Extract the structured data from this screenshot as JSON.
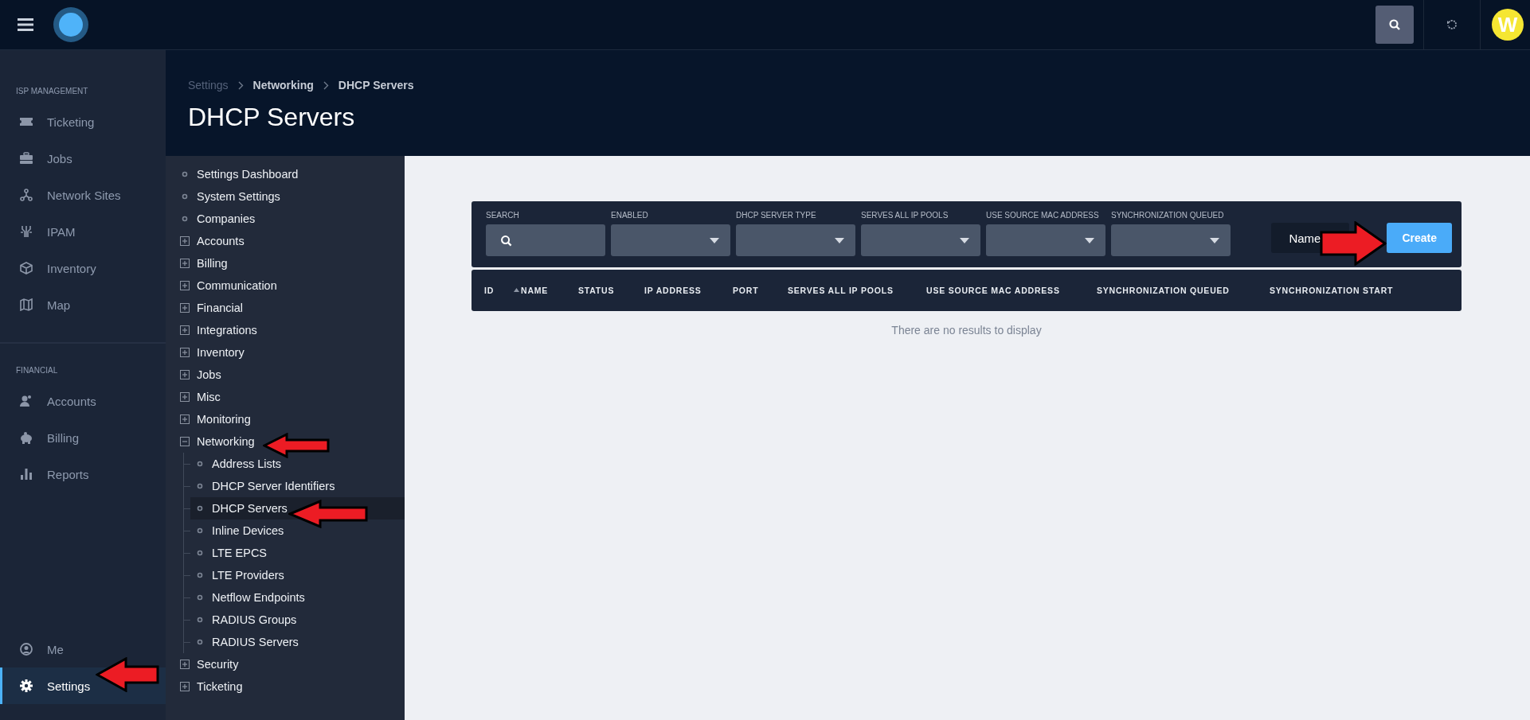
{
  "topbar": {
    "avatar_initial": "W"
  },
  "sidebar": {
    "sections": [
      {
        "heading": "ISP MANAGEMENT",
        "items": [
          {
            "label": "Ticketing",
            "selected": false
          },
          {
            "label": "Jobs",
            "selected": false
          },
          {
            "label": "Network Sites",
            "selected": false
          },
          {
            "label": "IPAM",
            "selected": false
          },
          {
            "label": "Inventory",
            "selected": false
          },
          {
            "label": "Map",
            "selected": false
          }
        ]
      },
      {
        "heading": "FINANCIAL",
        "items": [
          {
            "label": "Accounts",
            "selected": false
          },
          {
            "label": "Billing",
            "selected": false
          },
          {
            "label": "Reports",
            "selected": false
          }
        ]
      }
    ],
    "bottom_items": [
      {
        "label": "Me",
        "selected": false
      },
      {
        "label": "Settings",
        "selected": true
      }
    ]
  },
  "breadcrumb": [
    "Settings",
    "Networking",
    "DHCP Servers"
  ],
  "page_title": "DHCP Servers",
  "settings_tree": [
    {
      "label": "Settings Dashboard",
      "kind": "leaf",
      "selected": false
    },
    {
      "label": "System Settings",
      "kind": "leaf",
      "selected": false
    },
    {
      "label": "Companies",
      "kind": "leaf",
      "selected": false
    },
    {
      "label": "Accounts",
      "kind": "group",
      "expanded": false,
      "selected": false
    },
    {
      "label": "Billing",
      "kind": "group",
      "expanded": false,
      "selected": false
    },
    {
      "label": "Communication",
      "kind": "group",
      "expanded": false,
      "selected": false
    },
    {
      "label": "Financial",
      "kind": "group",
      "expanded": false,
      "selected": false
    },
    {
      "label": "Integrations",
      "kind": "group",
      "expanded": false,
      "selected": false
    },
    {
      "label": "Inventory",
      "kind": "group",
      "expanded": false,
      "selected": false
    },
    {
      "label": "Jobs",
      "kind": "group",
      "expanded": false,
      "selected": false
    },
    {
      "label": "Misc",
      "kind": "group",
      "expanded": false,
      "selected": false
    },
    {
      "label": "Monitoring",
      "kind": "group",
      "expanded": false,
      "selected": false
    },
    {
      "label": "Networking",
      "kind": "group",
      "expanded": true,
      "selected": false,
      "children": [
        {
          "label": "Address Lists",
          "selected": false
        },
        {
          "label": "DHCP Server Identifiers",
          "selected": false
        },
        {
          "label": "DHCP Servers",
          "selected": true
        },
        {
          "label": "Inline Devices",
          "selected": false
        },
        {
          "label": "LTE EPCS",
          "selected": false
        },
        {
          "label": "LTE Providers",
          "selected": false
        },
        {
          "label": "Netflow Endpoints",
          "selected": false
        },
        {
          "label": "RADIUS Groups",
          "selected": false
        },
        {
          "label": "RADIUS Servers",
          "selected": false
        }
      ]
    },
    {
      "label": "Security",
      "kind": "group",
      "expanded": false,
      "selected": false
    },
    {
      "label": "Ticketing",
      "kind": "group",
      "expanded": false,
      "selected": false
    }
  ],
  "filters": [
    {
      "label": "SEARCH",
      "kind": "search"
    },
    {
      "label": "ENABLED",
      "kind": "select"
    },
    {
      "label": "DHCP SERVER TYPE",
      "kind": "select"
    },
    {
      "label": "SERVES ALL IP POOLS",
      "kind": "select"
    },
    {
      "label": "USE SOURCE MAC ADDRESS",
      "kind": "select"
    },
    {
      "label": "SYNCHRONIZATION QUEUED",
      "kind": "select"
    }
  ],
  "sort_button": "Name",
  "create_button": "Create",
  "table": {
    "columns": [
      {
        "label": "ID",
        "sorted": false
      },
      {
        "label": "NAME",
        "sorted": true
      },
      {
        "label": "STATUS",
        "sorted": false
      },
      {
        "label": "IP ADDRESS",
        "sorted": false
      },
      {
        "label": "PORT",
        "sorted": false
      },
      {
        "label": "SERVES ALL IP POOLS",
        "sorted": false
      },
      {
        "label": "USE SOURCE MAC ADDRESS",
        "sorted": false
      },
      {
        "label": "SYNCHRONIZATION QUEUED",
        "sorted": false
      },
      {
        "label": "SYNCHRONIZATION START",
        "sorted": false
      }
    ],
    "empty_message": "There are no results to display"
  }
}
